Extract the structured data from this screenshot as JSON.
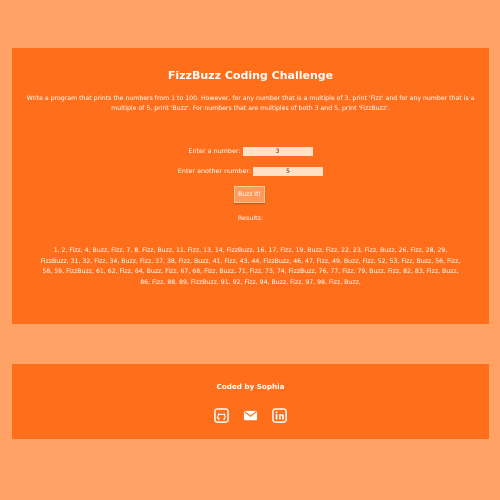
{
  "header": {
    "title": "FizzBuzz Coding Challenge",
    "description": "Write a program that prints the numbers from 1 to 100. However, for any number that is a multiple of 3, print 'Fizz' and for any number that is a multiple of 5, print 'Buzz'. For numbers that are multiples of both 3 and 5, print 'FizzBuzz'."
  },
  "form": {
    "first_label": "Enter a number:",
    "first_value": "3",
    "second_label": "Enter another number:",
    "second_value": "5",
    "button_label": "Buzz It!"
  },
  "results": {
    "label": "Results:",
    "text": "1, 2, Fizz, 4, Buzz, Fizz, 7, 8, Fizz, Buzz, 11, Fizz, 13, 14, FizzBuzz, 16, 17, Fizz, 19, Buzz, Fizz, 22, 23, Fizz, Buzz, 26, Fizz, 28, 29, FizzBuzz, 31, 32, Fizz, 34, Buzz, Fizz, 37, 38, Fizz, Buzz, 41, Fizz, 43, 44, FizzBuzz, 46, 47, Fizz, 49, Buzz, Fizz, 52, 53, Fizz, Buzz, 56, Fizz, 58, 59, FizzBuzz, 61, 62, Fizz, 64, Buzz, Fizz, 67, 68, Fizz, Buzz, 71, Fizz, 73, 74, FizzBuzz, 76, 77, Fizz, 79, Buzz, Fizz, 82, 83, Fizz, Buzz, 86, Fizz, 88, 89, FizzBuzz, 91, 92, Fizz, 94, Buzz, Fizz, 97, 98, Fizz, Buzz,"
  },
  "footer": {
    "credit": "Coded by Sophia",
    "icons": [
      "github-icon",
      "email-icon",
      "linkedin-icon"
    ]
  },
  "colors": {
    "page_background": "#ffa266",
    "card_background": "#ff6e1a",
    "text": "#ffffff",
    "input_background": "#ffe2c6",
    "button_background": "#ff9a5a"
  }
}
